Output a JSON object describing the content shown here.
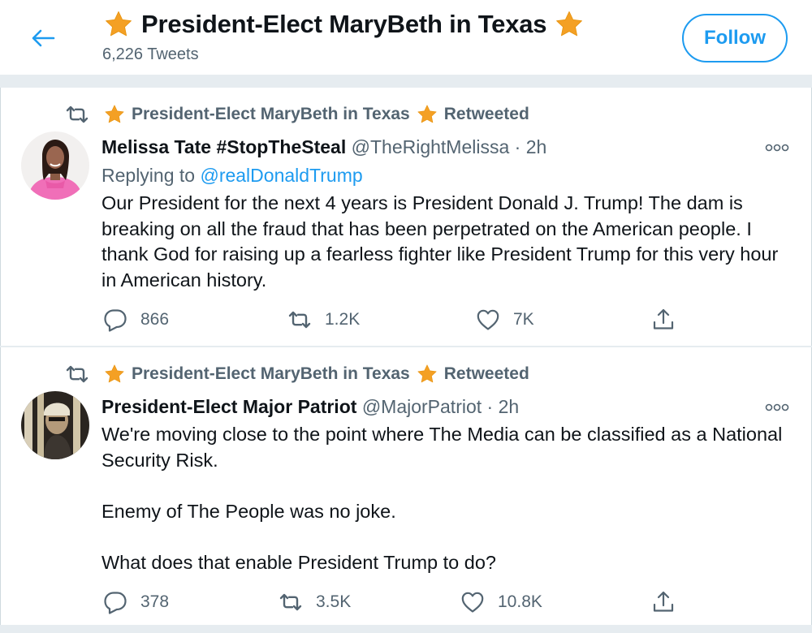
{
  "header": {
    "title": "President-Elect MaryBeth in Texas",
    "tweet_count": "6,226 Tweets",
    "follow_label": "Follow"
  },
  "icons": {
    "back": "back-arrow-icon",
    "star": "star-emoji-icon",
    "retweet": "retweet-icon",
    "reply": "reply-icon",
    "like": "heart-icon",
    "share": "share-icon",
    "more": "more-dots-icon"
  },
  "colors": {
    "accent": "#1d9bf0",
    "muted": "#536471",
    "star": "#f4a024"
  },
  "tweets": [
    {
      "retweeted_by": "President-Elect MaryBeth in Texas",
      "retweeted_label": "Retweeted",
      "display_name": "Melissa Tate #StopTheSteal",
      "handle": "@TheRightMelissa",
      "separator": "·",
      "time": "2h",
      "replying_prefix": "Replying to",
      "replying_to": "@realDonaldTrump",
      "text": [
        "Our President for the next 4 years is President Donald J. Trump! The dam is breaking on all the fraud that has been perpetrated on the American people. I thank God for raising up a fearless fighter like President Trump for this very hour in American history."
      ],
      "replies": "866",
      "retweets": "1.2K",
      "likes": "7K"
    },
    {
      "retweeted_by": "President-Elect MaryBeth in Texas",
      "retweeted_label": "Retweeted",
      "display_name": "President-Elect Major Patriot",
      "handle": "@MajorPatriot",
      "separator": "·",
      "time": "2h",
      "text": [
        "We're moving close to the point where The Media can be classified as a National Security Risk.",
        "Enemy of The People was no joke.",
        "What does that enable President Trump to do?"
      ],
      "replies": "378",
      "retweets": "3.5K",
      "likes": "10.8K"
    }
  ]
}
